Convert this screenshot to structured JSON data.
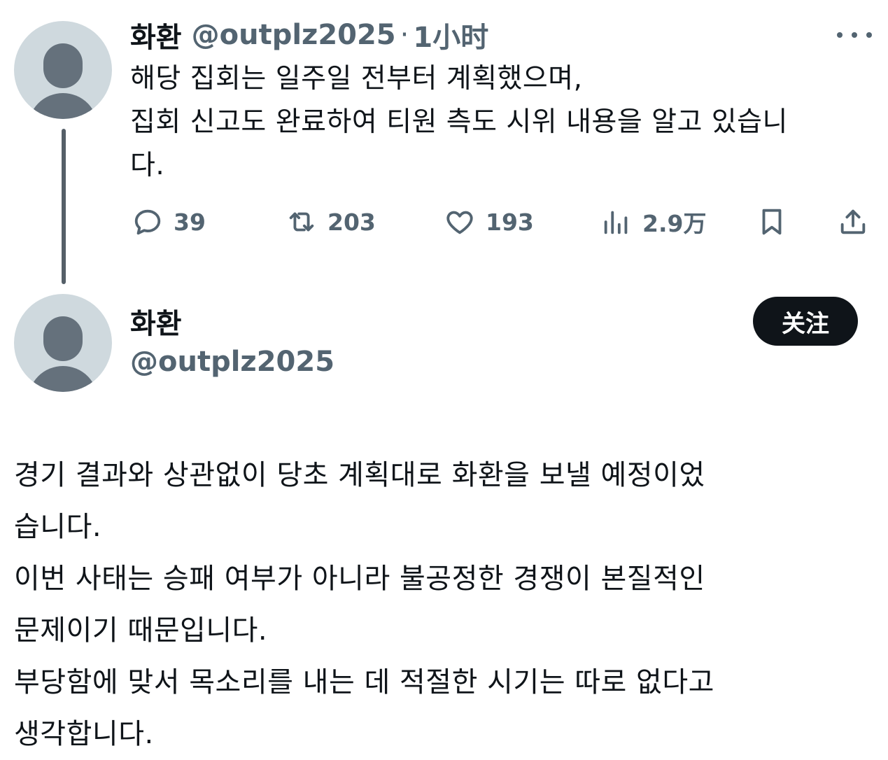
{
  "tweet": {
    "name": "화환",
    "handle": "@outplz2025",
    "separator": "·",
    "time": "1小时",
    "text": "해당 집회는 일주일 전부터 계획했으며,\n집회 신고도 완료하여 티원 측도 시위 내용을 알고 있습니\n다.",
    "stats": {
      "replies": "39",
      "reposts": "203",
      "likes": "193",
      "views": "2.9万"
    }
  },
  "profile": {
    "name": "화환",
    "handle": "@outplz2025",
    "follow_label": "关注"
  },
  "statement": {
    "text": "경기 결과와 상관없이 당초 계획대로 화환을 보낼 예정이었\n습니다.\n이번 사태는 승패 여부가 아니라 불공정한 경쟁이 본질적인\n문제이기 때문입니다.\n부당함에 맞서 목소리를 내는 데 적절한 시기는 따로 없다고\n생각합니다."
  },
  "icons": {
    "avatar": "default-avatar-icon",
    "more": "more-horizontal-icon",
    "reply": "reply-icon",
    "repost": "repost-icon",
    "like": "heart-icon",
    "views": "views-icon",
    "bookmark": "bookmark-icon",
    "share": "share-icon"
  },
  "colors": {
    "text": "#0f1419",
    "muted": "#536471",
    "avatar_bg": "#cfd9de",
    "avatar_fg": "#65717c",
    "follow_bg": "#0f1419"
  }
}
